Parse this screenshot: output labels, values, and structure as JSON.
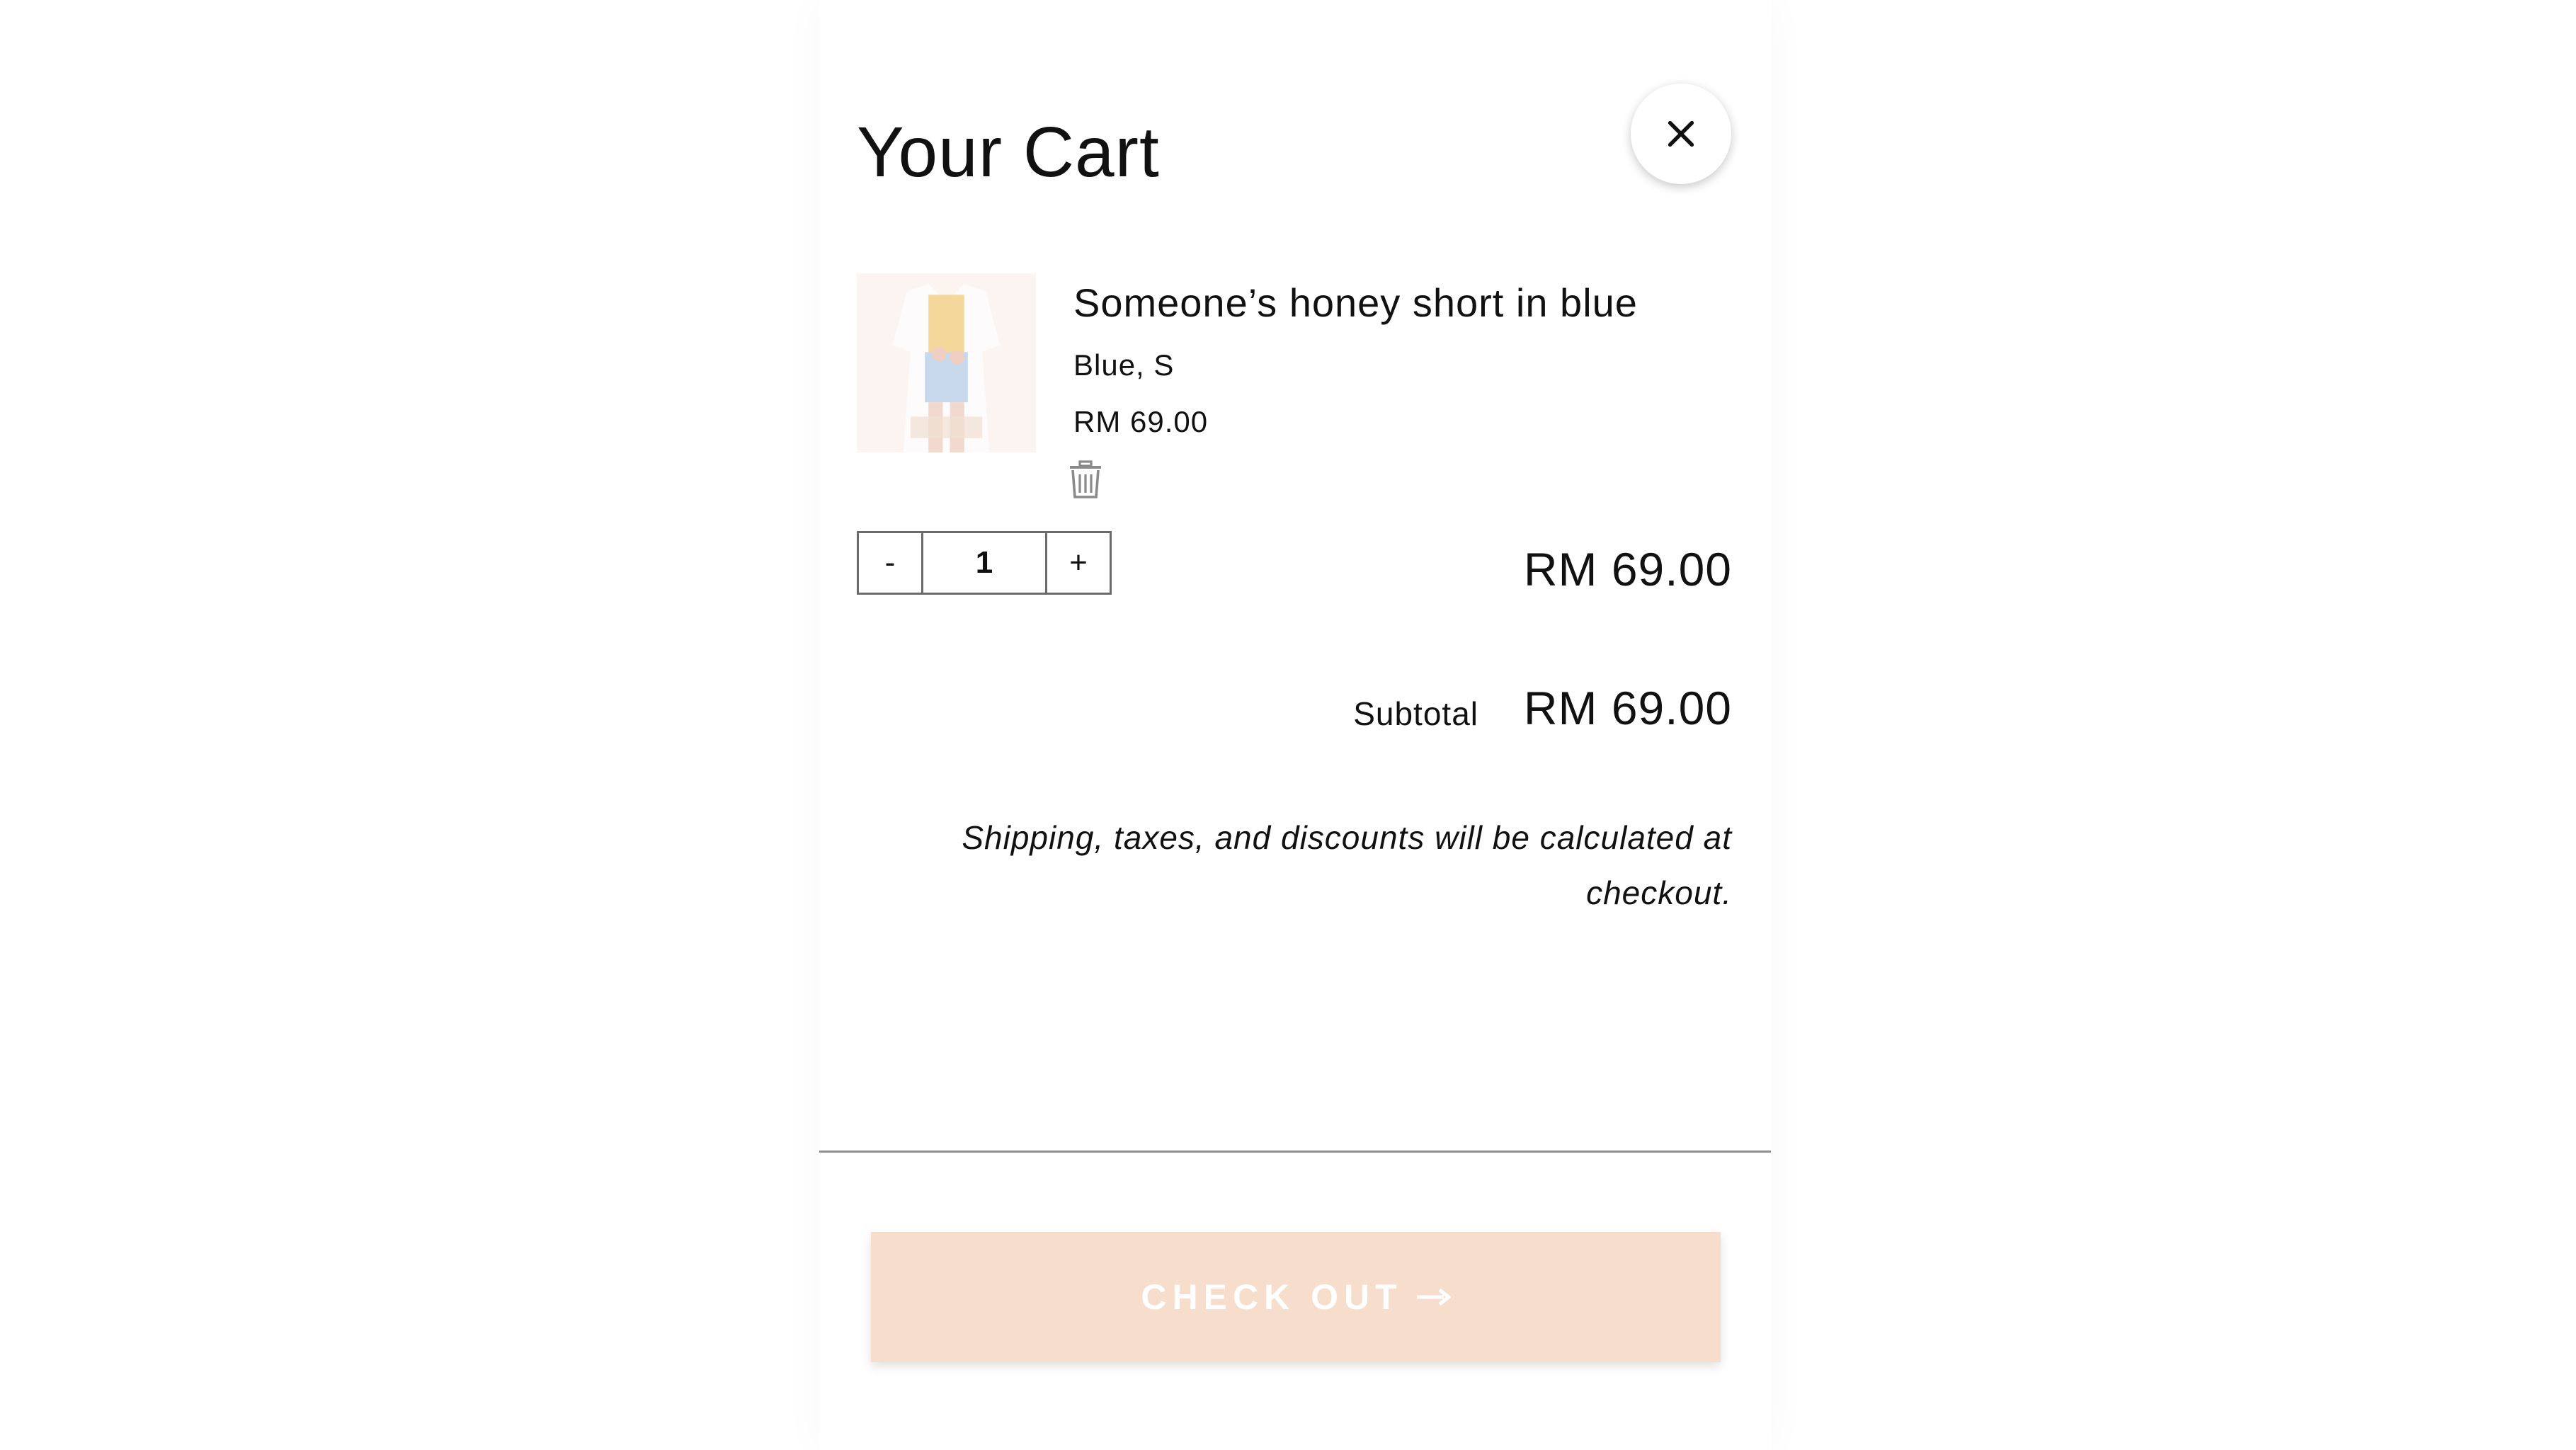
{
  "cart": {
    "title": "Your Cart",
    "close_icon": "close-icon"
  },
  "item": {
    "name": "Someone’s honey short in blue",
    "variant": "Blue, S",
    "unit_price": "RM 69.00",
    "quantity": "1",
    "decrement_label": "-",
    "increment_label": "+",
    "line_total": "RM 69.00",
    "remove_icon": "trash-icon",
    "image": "product-thumbnail"
  },
  "summary": {
    "subtotal_label": "Subtotal",
    "subtotal_value": "RM 69.00",
    "note": "Shipping, taxes, and discounts will be calculated at checkout."
  },
  "checkout": {
    "label": "CHECK OUT",
    "arrow_icon": "arrow-right-icon",
    "background_color": "#f6ddcc",
    "text_color": "#ffffff"
  }
}
